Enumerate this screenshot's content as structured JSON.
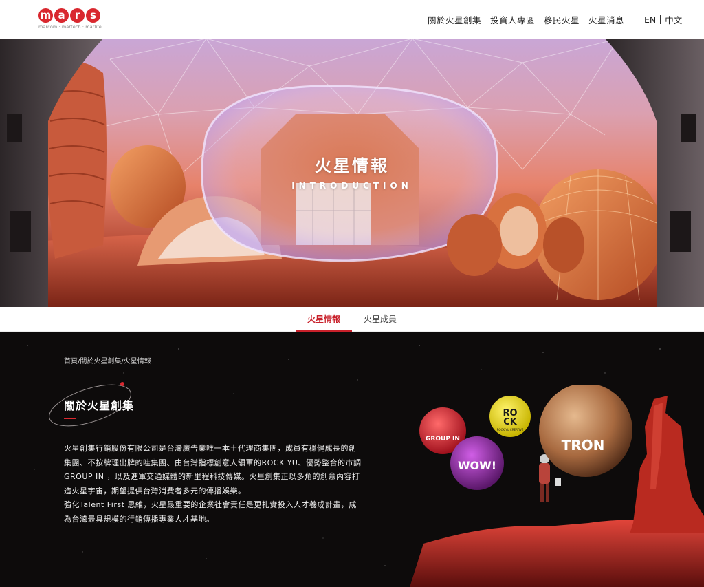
{
  "header": {
    "logo_letters": [
      "m",
      "a",
      "r",
      "s"
    ],
    "logo_tagline": "marcom · martech · marlife",
    "nav": [
      "關於火星創集",
      "投資人專區",
      "移民火星",
      "火星消息"
    ],
    "lang_en": "EN",
    "lang_zh": "中文"
  },
  "hero": {
    "title": "火星情報",
    "subtitle": "INTRODUCTION"
  },
  "tabs": {
    "active": "火星情報",
    "second": "火星成員"
  },
  "main": {
    "breadcrumb": "首頁/關於火星創集/火星情報",
    "section_title": "關於火星創集",
    "paragraph_lines": [
      "火星創集行銷股份有限公司是台灣廣告業唯一本土代理商集團，成員有穩健成長的創",
      "集團、不按牌理出牌的哇集團、由台灣指標創意人領軍的ROCK YU、優勢整合的市調",
      "GROUP IN ，以及進軍交通媒體的新里程科技傳媒。火星創集正以多角的創意內容打",
      "造火星宇宙，期望提供台灣消費者多元的傳播娛樂。",
      "強化Talent First 思維，火星最重要的企業社會責任是更扎實投入人才養成計畫，成",
      "為台灣最具規模的行銷傳播專業人才基地。"
    ]
  },
  "planets": {
    "group_in": "GROUP IN",
    "wow": "WOW!",
    "rock_top": "RO",
    "rock_bottom": "CK",
    "rock_caption": "ROCK YU CREATIVE",
    "tron": "TRON"
  },
  "colors": {
    "brand_red": "#d9282f",
    "tab_active": "#c8202a",
    "dark_bg": "#0d0b0b"
  }
}
